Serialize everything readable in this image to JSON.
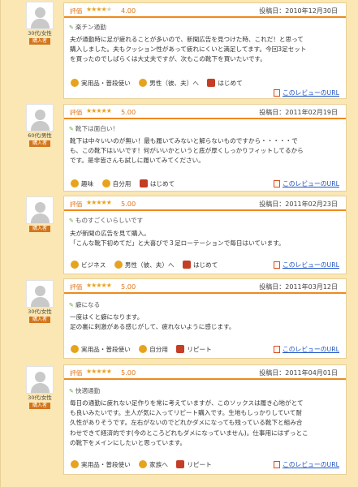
{
  "reviews": [
    {
      "age": "30代/女性",
      "badge": "購入者",
      "eval_label": "評価",
      "stars": 4,
      "score": "4.00",
      "posted": "投稿日：2010年12月30日",
      "title": "楽チン通勤",
      "body": [
        "夫が通勤時に足が疲れることが多いので、新聞広告を見つけた時、これだ！と思って",
        "購入しました。夫もクッション性があって疲れにくいと満足してます。今回3足セット",
        "を買ったのでしばらくは大丈夫ですが、次もこの靴下を買いたいです。"
      ],
      "tags": [
        "実用品・普段使い",
        "男性（彼、夫）へ",
        "はじめて"
      ],
      "tag_icons": [
        "smile-icon",
        "man-icon",
        "gift-icon"
      ],
      "url": "このレビューのURL"
    },
    {
      "age": "60代/男性",
      "badge": "購入者",
      "eval_label": "評価",
      "stars": 5,
      "score": "5.00",
      "posted": "投稿日：2011年02月19日",
      "title": "靴下は面白い！",
      "body": [
        "靴下は中々いいのが無い！最も履いてみないと解らないものですから・・・・・で",
        "も、この靴下はいいです！何がいいかというと底が厚くしっかりフィットしてるから",
        "です。是非皆さんも試しに履いてみてください。"
      ],
      "tags": [
        "趣味",
        "自分用",
        "はじめて"
      ],
      "tag_icons": [
        "smile-icon",
        "man-icon",
        "gift-icon"
      ],
      "url": "このレビューのURL"
    },
    {
      "age": "",
      "badge": "購入者",
      "eval_label": "評価",
      "stars": 5,
      "score": "5.00",
      "posted": "投稿日：2011年02月23日",
      "title": "ものすごくいらしいです",
      "body": [
        "夫が新聞の広告を見て購入。",
        "「こんな靴下初めてだ」と大喜びで３足ローテーションで毎日はいています。"
      ],
      "tags": [
        "ビジネス",
        "男性（彼、夫）へ",
        "はじめて"
      ],
      "tag_icons": [
        "smile-icon",
        "man-icon",
        "gift-icon"
      ],
      "url": "このレビューのURL"
    },
    {
      "age": "30代/女性",
      "badge": "購入者",
      "eval_label": "評価",
      "stars": 5,
      "score": "5.00",
      "posted": "投稿日：2011年03月12日",
      "title": "癖になる",
      "body": [
        "一度はくと癖になります。",
        "足の裏に刺激がある感じがして、疲れないように感じます。"
      ],
      "tags": [
        "実用品・普段使い",
        "自分用",
        "リピート"
      ],
      "tag_icons": [
        "smile-icon",
        "man-icon",
        "gift-icon"
      ],
      "url": "このレビューのURL"
    },
    {
      "age": "30代/女性",
      "badge": "購入者",
      "eval_label": "評価",
      "stars": 5,
      "score": "5.00",
      "posted": "投稿日：2011年04月01日",
      "title": "快適通勤",
      "body": [
        "毎日の通勤に疲れない足作りを常に考えていますが、このソックスは履き心地がとて",
        "も良いみたいです。主人が気に入ってリピート購入です。生地もしっかりしていて耐",
        "久性がありそうです。左右がないのでどれかダメになっても残っている靴下と組み合",
        "わせできて経済的です(今のところどれもダメになっていません)。仕事用にはずっとこ",
        "の靴下をメインにしたいと思っています。"
      ],
      "tags": [
        "実用品・普段使い",
        "家族へ",
        "リピート"
      ],
      "tag_icons": [
        "smile-icon",
        "man-icon",
        "gift-icon"
      ],
      "url": "このレビューのURL"
    }
  ]
}
